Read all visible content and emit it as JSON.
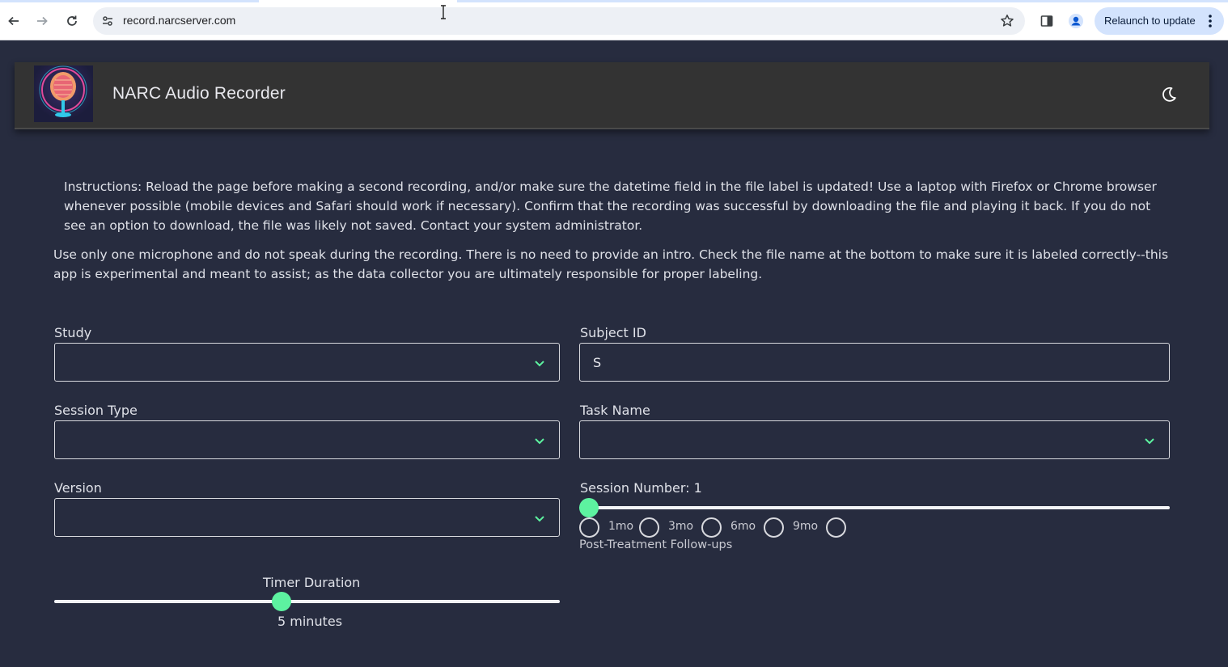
{
  "browser": {
    "url": "record.narcserver.com",
    "relaunch_label": "Relaunch to update"
  },
  "app": {
    "title": "NARC Audio Recorder"
  },
  "instructions": {
    "paragraph1": "Instructions: Reload the page before making a second recording, and/or make sure the datetime field in the file label is updated! Use a laptop with Firefox or Chrome browser whenever possible (mobile devices and Safari should work if necessary). Confirm that the recording was successful by downloading the file and playing it back. If you do not see an option to download, the file was likely not saved. Contact your system administrator.",
    "paragraph2": "Use only one microphone and do not speak during the recording. There is no need to provide an intro. Check the file name at the bottom to make sure it is labeled correctly--this app is experimental and meant to assist; as the data collector you are ultimately responsible for proper labeling."
  },
  "form": {
    "study_label": "Study",
    "study_value": "",
    "subject_id_label": "Subject ID",
    "subject_id_value": "S",
    "session_type_label": "Session Type",
    "session_type_value": "",
    "task_name_label": "Task Name",
    "task_name_value": "",
    "version_label": "Version",
    "version_value": "",
    "session_number_label": "Session Number: 1",
    "session_number_value": 1,
    "followup_options": [
      "1mo",
      "3mo",
      "6mo",
      "9mo"
    ],
    "followup_caption": "Post-Treatment Follow-ups",
    "timer_label": "Timer Duration",
    "timer_value_text": "5 minutes",
    "timer_fraction": 0.45
  },
  "colors": {
    "background": "#272c3f",
    "accent": "#5df2a0",
    "appbar": "#333333"
  },
  "icons": [
    "back-arrow-icon",
    "forward-arrow-icon",
    "reload-icon",
    "site-settings-icon",
    "bookmark-star-icon",
    "side-panel-icon",
    "profile-icon",
    "more-vert-icon",
    "moon-icon",
    "chevron-down-icon"
  ]
}
